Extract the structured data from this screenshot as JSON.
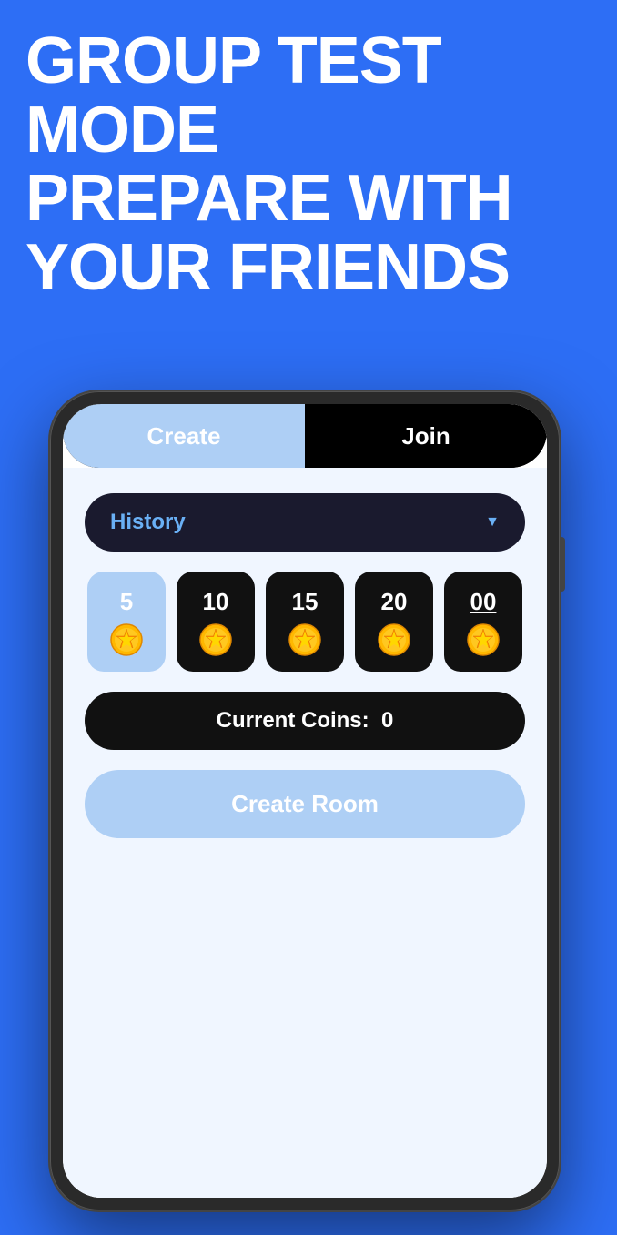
{
  "hero": {
    "title_line1": "GROUP TEST MODE",
    "title_line2": "PREPARE WITH",
    "title_line3": "YOUR FRIENDS"
  },
  "tabs": {
    "create_label": "Create",
    "join_label": "Join"
  },
  "history_dropdown": {
    "label": "History",
    "arrow": "▼"
  },
  "coin_options": [
    {
      "value": "5",
      "selected": true
    },
    {
      "value": "10",
      "selected": false
    },
    {
      "value": "15",
      "selected": false
    },
    {
      "value": "20",
      "selected": false
    },
    {
      "value": "00",
      "underline": true,
      "selected": false
    }
  ],
  "current_coins": {
    "label": "Current Coins:",
    "value": "0"
  },
  "create_room_button": {
    "label": "Create Room"
  },
  "colors": {
    "background": "#2D6EF5",
    "tab_active_bg": "#aecff5",
    "tab_inactive_bg": "#000000",
    "card_bg": "#111111",
    "selected_card_bg": "#aecff5"
  }
}
